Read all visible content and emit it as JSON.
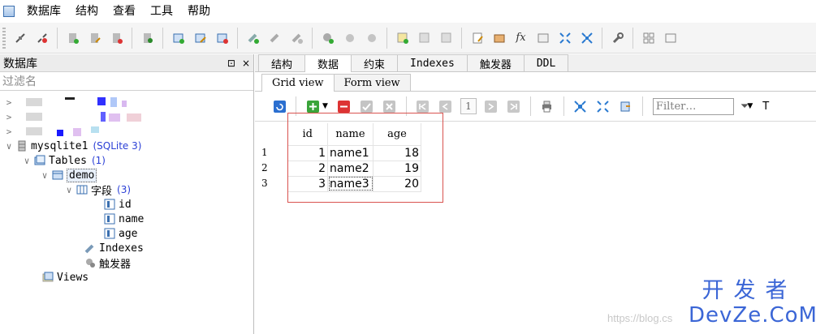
{
  "menubar": {
    "items": [
      "数据库",
      "结构",
      "查看",
      "工具",
      "帮助"
    ]
  },
  "toolbar": {
    "fx_label": "fx"
  },
  "left_panel": {
    "title": "数据库",
    "pin_icon": "⊡",
    "close_icon": "×",
    "filter_placeholder": "过滤名",
    "tree": {
      "db_name": "mysqlite1",
      "db_type": "(SQLite 3)",
      "tables_label": "Tables",
      "tables_count": "(1)",
      "table_name": "demo",
      "fields_label": "字段",
      "fields_count": "(3)",
      "fields": [
        "id",
        "name",
        "age"
      ],
      "indexes_label": "Indexes",
      "triggers_label": "触发器",
      "views_label": "Views"
    }
  },
  "right_panel": {
    "tabs": [
      "结构",
      "数据",
      "约束",
      "Indexes",
      "触发器",
      "DDL"
    ],
    "active_tab": "数据",
    "subtabs": [
      "Grid view",
      "Form view"
    ],
    "active_subtab": "Grid view",
    "grid_toolbar": {
      "page_number": "1",
      "filter_placeholder": "Filter…",
      "trailing_label": "T"
    },
    "grid": {
      "columns": [
        "id",
        "name",
        "age"
      ],
      "rows": [
        {
          "num": "1",
          "id": "1",
          "name": "name1",
          "age": "18"
        },
        {
          "num": "2",
          "id": "2",
          "name": "name2",
          "age": "19"
        },
        {
          "num": "3",
          "id": "3",
          "name": "name3",
          "age": "20"
        }
      ]
    }
  },
  "watermark": {
    "url": "https://blog.cs",
    "logo_cn": "开发者",
    "logo_en": "DevZe.CoM"
  },
  "colors": {
    "accent_blue": "#2b3fd6",
    "highlight_red": "#d9534f",
    "logo_blue": "#3b66d6"
  }
}
